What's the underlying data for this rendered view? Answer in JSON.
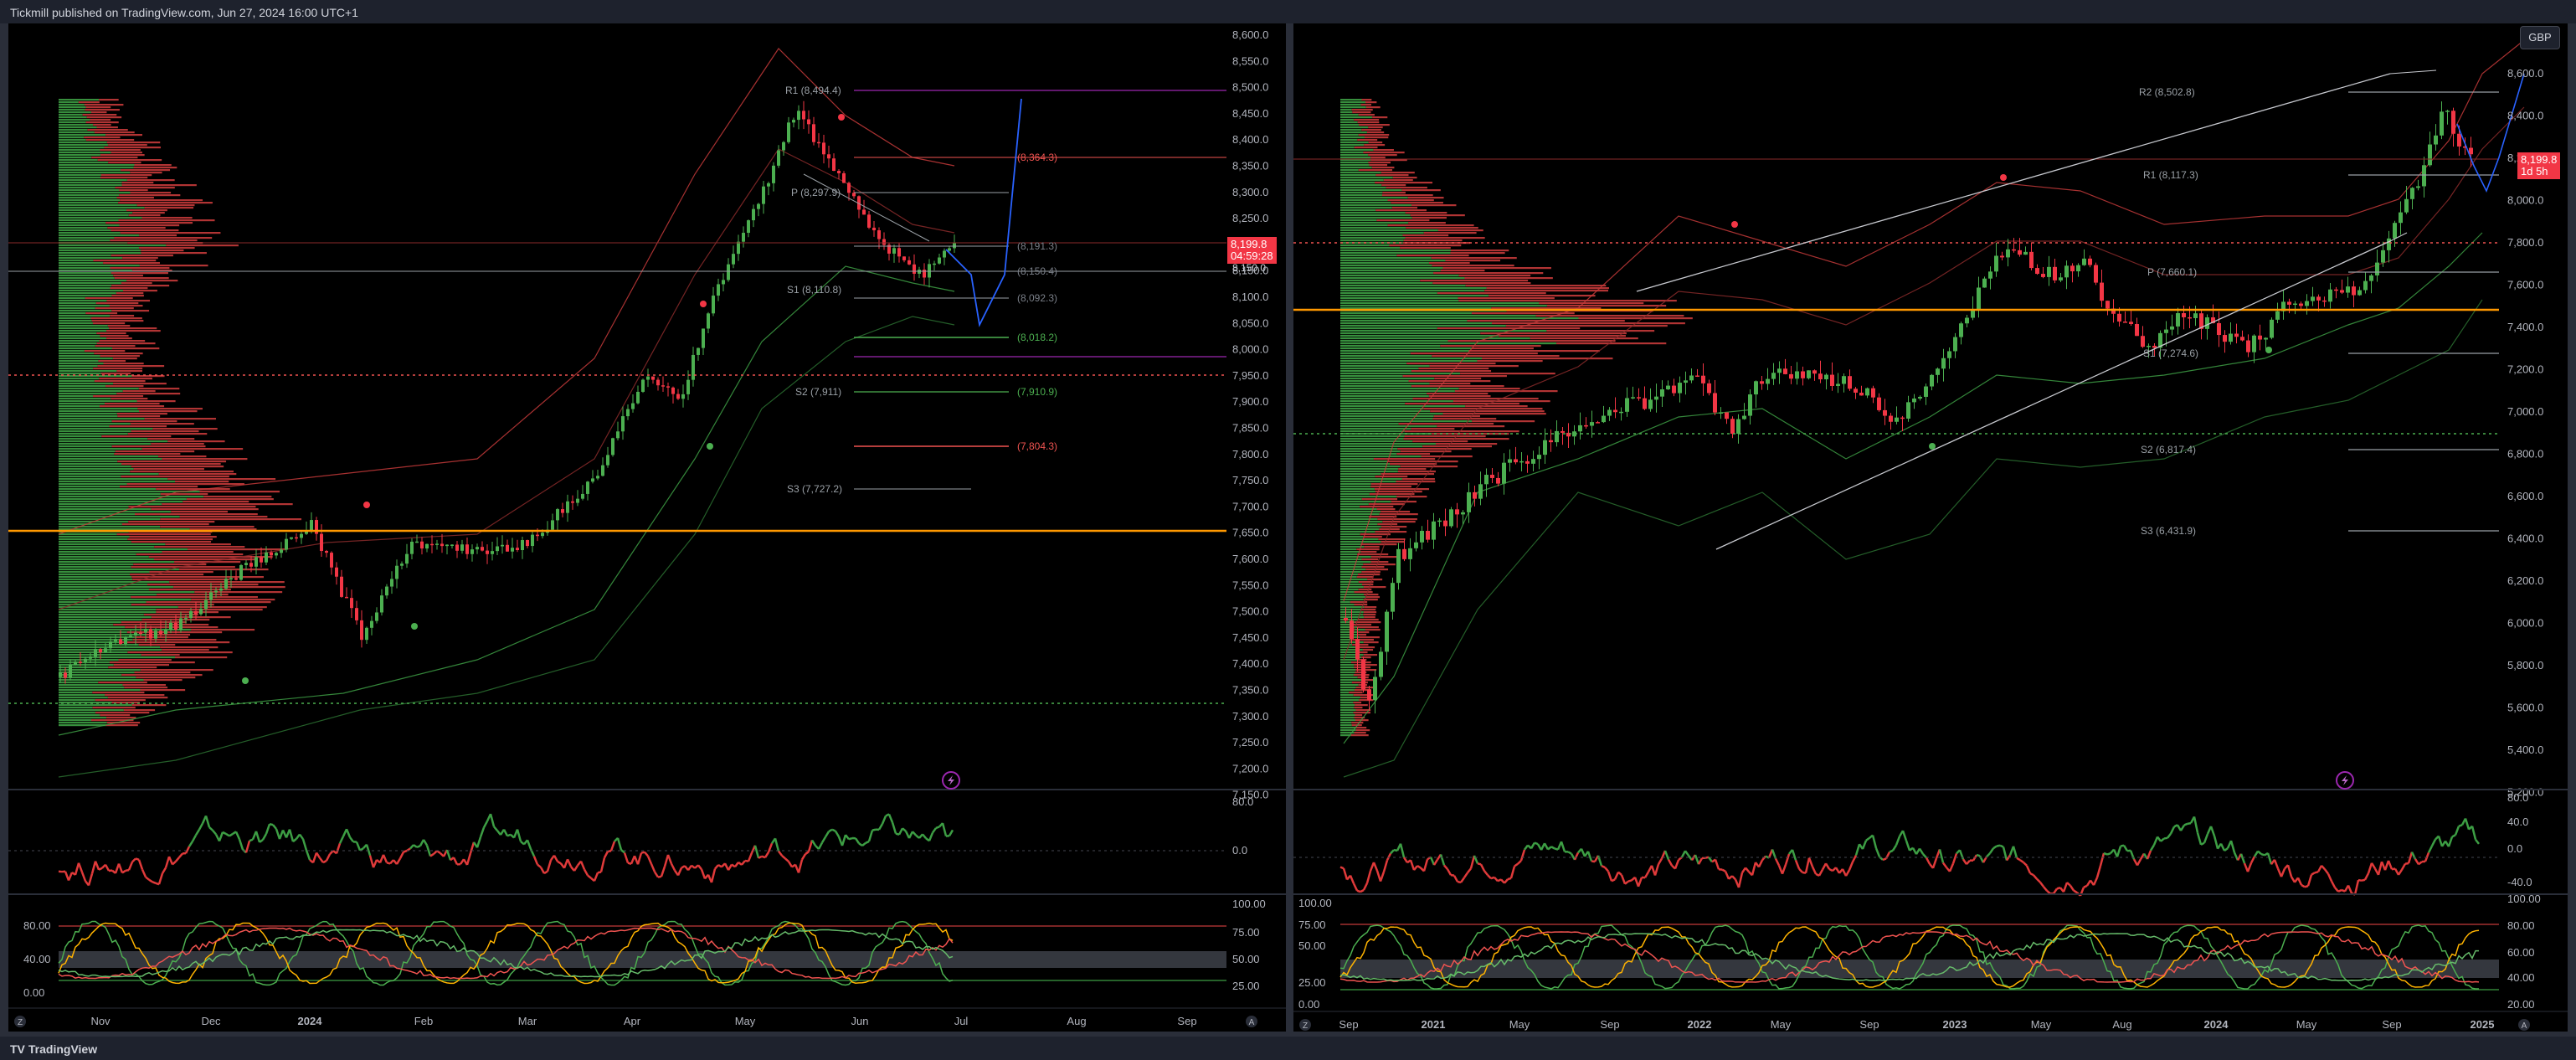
{
  "header": {
    "publish_text": "Tickmill published on TradingView.com, Jun 27, 2024 16:00 UTC+1"
  },
  "footer": {
    "logo_mark": "TV",
    "logo_text": "TradingView"
  },
  "colors": {
    "up": "#4caf50",
    "down": "#f23645",
    "orange": "#ff9800",
    "blue": "#2962ff",
    "purple": "#9c27b0",
    "grid": "#1a1d25"
  },
  "left_chart": {
    "price_axis": [
      "8,600.0",
      "8,550.0",
      "8,500.0",
      "8,450.0",
      "8,400.0",
      "8,350.0",
      "8,300.0",
      "8,250.0",
      "8,200.0",
      "8,150.0",
      "8,100.0",
      "8,050.0",
      "8,000.0",
      "7,950.0",
      "7,900.0",
      "7,850.0",
      "7,800.0",
      "7,750.0",
      "7,700.0",
      "7,650.0",
      "7,600.0",
      "7,550.0",
      "7,500.0",
      "7,450.0",
      "7,400.0",
      "7,350.0",
      "7,300.0",
      "7,250.0",
      "7,200.0",
      "7,150.0"
    ],
    "time_axis": [
      "Nov",
      "Dec",
      "2024",
      "Feb",
      "Mar",
      "Apr",
      "May",
      "Jun",
      "Jul",
      "Aug",
      "Sep"
    ],
    "pivot_labels": [
      "R1 (8,494.4)",
      "P (8,297.9)",
      "S1 (8,110.8)",
      "S2 (7,911)",
      "S3 (7,727.2)"
    ],
    "level_labels": [
      "(8,364.3)",
      "(8,191.3)",
      "(8,150.4)",
      "(8,092.3)",
      "(8,018.2)",
      "(7,910.9)",
      "(7,804.3)"
    ],
    "current_price": "8,199.8",
    "countdown": "04:59:28",
    "price_8150": "8,150.0",
    "rsi_axis": [
      "80.0",
      "0.0"
    ],
    "stoch_axis_right": [
      "100.00",
      "75.00",
      "50.00",
      "25.00"
    ],
    "stoch_axis_left": [
      "80.00",
      "40.00",
      "0.00"
    ],
    "corner_left": "Z",
    "corner_right": "A"
  },
  "right_chart": {
    "currency": "GBP",
    "price_axis": [
      "8,600.0",
      "8,400.0",
      "8,200.0",
      "8,000.0",
      "7,800.0",
      "7,600.0",
      "7,400.0",
      "7,200.0",
      "7,000.0",
      "6,800.0",
      "6,600.0",
      "6,400.0",
      "6,200.0",
      "6,000.0",
      "5,800.0",
      "5,600.0",
      "5,400.0",
      "5,200.0"
    ],
    "time_axis": [
      "Sep",
      "2021",
      "May",
      "Sep",
      "2022",
      "May",
      "Sep",
      "2023",
      "May",
      "Aug",
      "2024",
      "May",
      "Sep",
      "2025"
    ],
    "pivot_labels": [
      "R2 (8,502.8)",
      "R1 (8,117.3)",
      "P (7,660.1)",
      "S1 (7,274.6)",
      "S2 (6,817.4)",
      "S3 (6,431.9)"
    ],
    "current_price": "8,199.8",
    "countdown": "1d 5h",
    "rsi_axis": [
      "80.0",
      "40.0",
      "0.0",
      "-40.0"
    ],
    "stoch_axis_right": [
      "100.00",
      "80.00",
      "60.00",
      "40.00",
      "20.00"
    ],
    "stoch_axis_left": [
      "100.00",
      "75.00",
      "50.00",
      "25.00",
      "0.00"
    ],
    "corner_left": "Z",
    "corner_right": "A"
  }
}
